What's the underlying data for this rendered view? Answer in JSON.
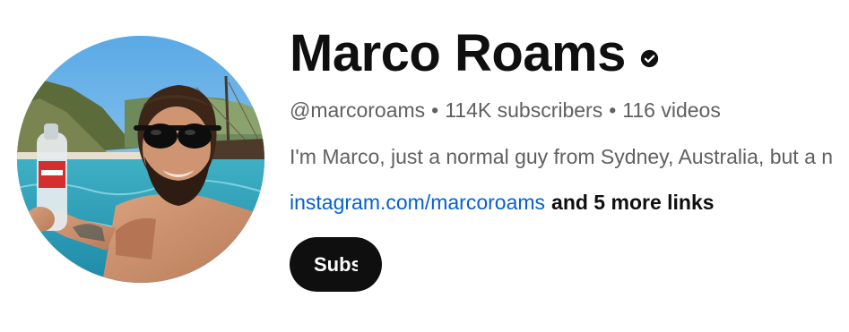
{
  "channel": {
    "name": "Marco Roams",
    "verified_icon": "verified-check-icon",
    "handle": "@marcoroams",
    "separator": "•",
    "subscribers": "114K subscribers",
    "videos": "116 videos",
    "description": "I'm Marco, just a normal guy from Sydney, Australia, but a n",
    "link_text": "instagram.com/marcoroams",
    "more_links": "and 5 more links",
    "subscribe_label": "Subscribe"
  },
  "colors": {
    "text_primary": "#0f0f0f",
    "text_secondary": "#606060",
    "link": "#065fd4",
    "subscribe_bg": "#0f0f0f",
    "subscribe_text": "#ffffff"
  }
}
